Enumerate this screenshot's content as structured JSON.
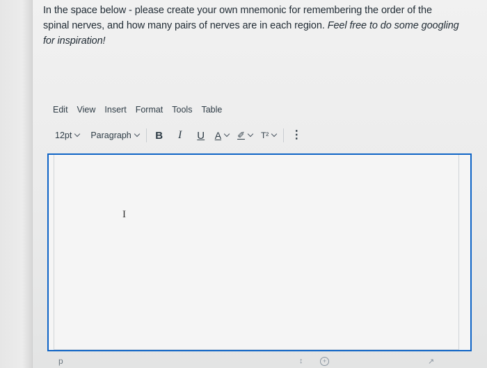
{
  "question": {
    "text_regular": "In the space below - please create your own mnemonic for remembering the order of the spinal nerves, and how many pairs of nerves are in each region. ",
    "text_italic": "Feel free to do some googling for inspiration!"
  },
  "menubar": {
    "edit": "Edit",
    "view": "View",
    "insert": "Insert",
    "format": "Format",
    "tools": "Tools",
    "table": "Table"
  },
  "toolbar": {
    "font_size": "12pt",
    "block_format": "Paragraph",
    "bold": "B",
    "italic": "I",
    "underline": "U",
    "text_color": "A",
    "highlight": "✐",
    "superscript": "T²",
    "more": "⋮"
  },
  "editor": {
    "content": "",
    "cursor_glyph": "I"
  },
  "statusbar": {
    "element_path": "p"
  },
  "colors": {
    "accent": "#0d63c6",
    "text": "#2d3b45"
  },
  "icons": [
    "chevron-down-icon",
    "text-cursor-icon",
    "highlighter-icon",
    "more-options-icon"
  ]
}
